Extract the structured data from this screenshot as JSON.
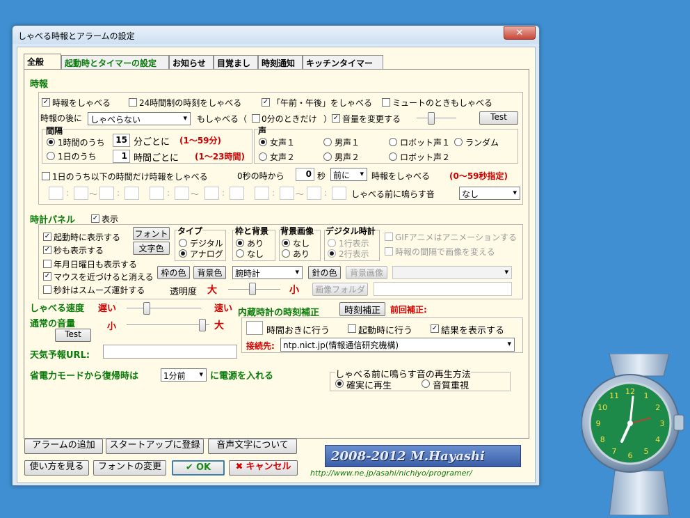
{
  "window": {
    "title": "しゃべる時報とアラームの設定",
    "close": "✕"
  },
  "tabs": [
    "全般",
    "起動時とタイマーの設定",
    "お知らせ",
    "目覚まし",
    "時刻通知",
    "キッチンタイマー"
  ],
  "jiho": {
    "section": "時報",
    "cb_speak": "時報をしゃべる",
    "cb_24h": "24時間制の時刻をしゃべる",
    "cb_ampm": "「午前・午後」をしゃべる",
    "cb_mute": "ミュートのときもしゃべる",
    "after_label": "時報の後に",
    "after_select": "しゃべらない",
    "also_speak": "もしゃべる（",
    "cb_zero": "0分のときだけ",
    "close_paren": "）",
    "cb_volume": "音量を変更する",
    "test_btn": "Test",
    "interval": {
      "title": "間隔",
      "hour_option": "1時間のうち",
      "day_option": "1日のうち",
      "minutes_value": "15",
      "minutes_label": "分ごとに",
      "minutes_range": "(1〜59分)",
      "hours_value": "1",
      "hours_label": "時間ごとに",
      "hours_range": "(1〜23時間)"
    },
    "voice": {
      "title": "声",
      "options": [
        "女声１",
        "男声１",
        "ロボット声１",
        "ランダム",
        "女声２",
        "男声２",
        "ロボット声２"
      ]
    },
    "limit_label": "1日のうち以下の時間だけ時報をしゃべる",
    "sec_prefix": "0秒の時から",
    "sec_value": "0",
    "sec_unit": "秒",
    "before_after": "前に",
    "speak_time": "時報をしゃべる",
    "sec_range": "(0〜59秒指定)",
    "tilde": "〜",
    "sound_label": "しゃべる前に鳴らす音",
    "sound_select": "なし"
  },
  "clock": {
    "section": "時計パネル",
    "show": "表示",
    "cb_startup": "起動時に表示する",
    "cb_seconds": "秒も表示する",
    "cb_date": "年月日曜日も表示する",
    "cb_mouse": "マウスを近づけると消える",
    "cb_smooth": "秒針はスムーズ運針する",
    "font_btn": "フォント",
    "textcolor_btn": "文字色",
    "type_title": "タイプ",
    "type_digital": "デジタル",
    "type_analog": "アナログ",
    "frame_title": "枠と背景",
    "frame_on": "あり",
    "frame_off": "なし",
    "bgimg_title": "背景画像",
    "bgimg_off": "なし",
    "bgimg_on": "あり",
    "digital_title": "デジタル時計",
    "digital_1": "1行表示",
    "digital_2": "2行表示",
    "gif_anim": "GIFアニメはアニメーションする",
    "change_img": "時報の間隔で画像を変える",
    "framecolor_btn": "枠の色",
    "bgcolor_btn": "背景色",
    "clock_select": "腕時計",
    "handcolor_btn": "針の色",
    "bgimage_btn": "背景画像",
    "transparency": "透明度",
    "big": "大",
    "small": "小",
    "imgfolder_btn": "画像フォルダ"
  },
  "speed": {
    "label": "しゃべる速度",
    "slow": "遅い",
    "fast": "速い",
    "value": 0.25
  },
  "volume": {
    "label": "通常の音量",
    "small": "小",
    "big": "大",
    "test": "Test",
    "value": 0.95
  },
  "correction": {
    "title": "内蔵時計の時刻補正",
    "btn": "時刻補正",
    "last": "前回補正:",
    "interval_label": "時間おきに行う",
    "cb_startup": "起動時に行う",
    "cb_result": "結果を表示する",
    "server_label": "接続先:",
    "server": "ntp.nict.jp(情報通信研究機構)"
  },
  "weather": {
    "label": "天気予報URL:"
  },
  "power": {
    "label": "省電力モードから復帰時は",
    "select": "1分前",
    "suffix": "に電源を入れる"
  },
  "playback": {
    "title": "しゃべる前に鳴らす音の再生方法",
    "sure": "確実に再生",
    "quality": "音質重視"
  },
  "buttons": {
    "add_alarm": "アラームの追加",
    "startup": "スタートアップに登録",
    "voice_text": "音声文字について",
    "howto": "使い方を見る",
    "font_change": "フォントの変更",
    "ok": "OK",
    "cancel": "キャンセル"
  },
  "credit": {
    "banner": "2008-2012 M.Hayashi",
    "url": "http://www.ne.jp/asahi/nichiyo/programer/"
  },
  "watch": {
    "numbers": [
      "12",
      "1",
      "2",
      "3",
      "4",
      "5",
      "6",
      "7",
      "8",
      "9",
      "10",
      "11"
    ]
  },
  "colors": {
    "section_green": "#0a7a0a",
    "accent_red": "#d00000",
    "desktop": "#3f8fd2",
    "dialog_bg": "#fffbe7"
  }
}
